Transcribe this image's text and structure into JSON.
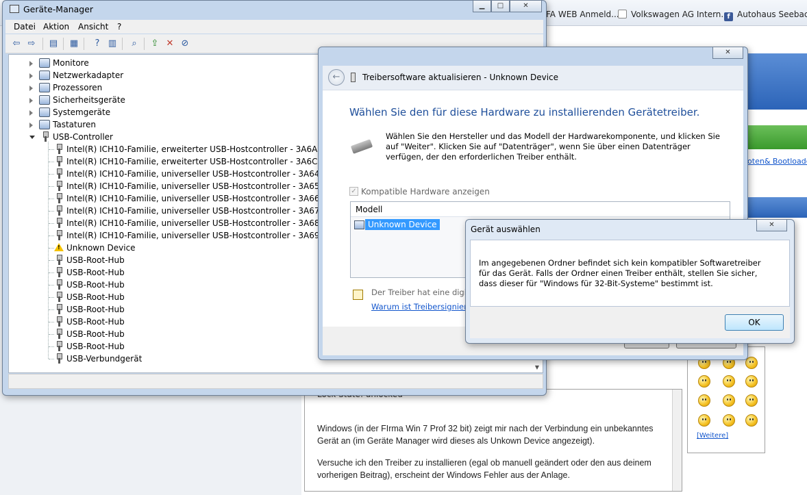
{
  "browser": {
    "bookmarks": [
      {
        "label": "FA WEB Anmeld..."
      },
      {
        "label": "Volkswagen AG Intern..."
      },
      {
        "label": "Autohaus Seebach",
        "icon": "facebook-icon"
      }
    ]
  },
  "forum": {
    "side_link": "loten& Bootloader",
    "lock_state": "Lock State: unlocked",
    "post_para_1": "Windows (in der FIrma Win 7 Prof 32 bit) zeigt mir nach der Verbindung ein unbekanntes Gerät an (im Geräte Manager wird dieses als Unkown Device angezeigt).",
    "post_para_2": "Versuche ich den Treiber zu installieren (egal ob manuell geändert oder den aus deinem vorherigen Beitrag), erscheint der Windows Fehler aus der Anlage.",
    "more_smileys": "[Weitere]"
  },
  "device_manager": {
    "title": "Geräte-Manager",
    "menu": [
      "Datei",
      "Aktion",
      "Ansicht",
      "?"
    ],
    "tree": {
      "categories": [
        {
          "label": "Monitore",
          "expanded": false
        },
        {
          "label": "Netzwerkadapter",
          "expanded": false
        },
        {
          "label": "Prozessoren",
          "expanded": false
        },
        {
          "label": "Sicherheitsgeräte",
          "expanded": false
        },
        {
          "label": "Systemgeräte",
          "expanded": false
        },
        {
          "label": "Tastaturen",
          "expanded": false
        },
        {
          "label": "USB-Controller",
          "expanded": true
        }
      ],
      "usb_devices": [
        {
          "label": "Intel(R) ICH10-Familie, erweiterter USB-Hostcontroller - 3A6A",
          "warning": false
        },
        {
          "label": "Intel(R) ICH10-Familie, erweiterter USB-Hostcontroller - 3A6C",
          "warning": false
        },
        {
          "label": "Intel(R) ICH10-Familie, universeller USB-Hostcontroller - 3A64",
          "warning": false
        },
        {
          "label": "Intel(R) ICH10-Familie, universeller USB-Hostcontroller - 3A65",
          "warning": false
        },
        {
          "label": "Intel(R) ICH10-Familie, universeller USB-Hostcontroller - 3A66",
          "warning": false
        },
        {
          "label": "Intel(R) ICH10-Familie, universeller USB-Hostcontroller - 3A67",
          "warning": false
        },
        {
          "label": "Intel(R) ICH10-Familie, universeller USB-Hostcontroller - 3A68",
          "warning": false
        },
        {
          "label": "Intel(R) ICH10-Familie, universeller USB-Hostcontroller - 3A69",
          "warning": false
        },
        {
          "label": "Unknown Device",
          "warning": true
        },
        {
          "label": "USB-Root-Hub",
          "warning": false
        },
        {
          "label": "USB-Root-Hub",
          "warning": false
        },
        {
          "label": "USB-Root-Hub",
          "warning": false
        },
        {
          "label": "USB-Root-Hub",
          "warning": false
        },
        {
          "label": "USB-Root-Hub",
          "warning": false
        },
        {
          "label": "USB-Root-Hub",
          "warning": false
        },
        {
          "label": "USB-Root-Hub",
          "warning": false
        },
        {
          "label": "USB-Root-Hub",
          "warning": false
        },
        {
          "label": "USB-Verbundgerät",
          "warning": false
        }
      ]
    }
  },
  "wizard": {
    "title": "Treibersoftware aktualisieren - Unknown Device",
    "heading": "Wählen Sie den für diese Hardware zu installierenden Gerätetreiber.",
    "description": "Wählen Sie den Hersteller und das Modell der Hardwarekomponente, und klicken Sie auf \"Weiter\". Klicken Sie auf \"Datenträger\", wenn Sie über einen Datenträger verfügen, der den erforderlichen Treiber enthält.",
    "compat_checkbox_label": "Kompatible Hardware anzeigen",
    "compat_checked": true,
    "model_column": "Modell",
    "model_selected": "Unknown Device",
    "signed_text": "Der Treiber hat eine digital",
    "why_link": "Warum ist Treibersignierun"
  },
  "error_dialog": {
    "title": "Gerät auswählen",
    "message": "Im angegebenen Ordner befindet sich kein kompatibler Softwaretreiber für das Gerät. Falls der Ordner einen Treiber enthält, stellen Sie sicher, dass dieser für \"Windows für 32-Bit-Systeme\" bestimmt ist.",
    "ok_label": "OK"
  }
}
